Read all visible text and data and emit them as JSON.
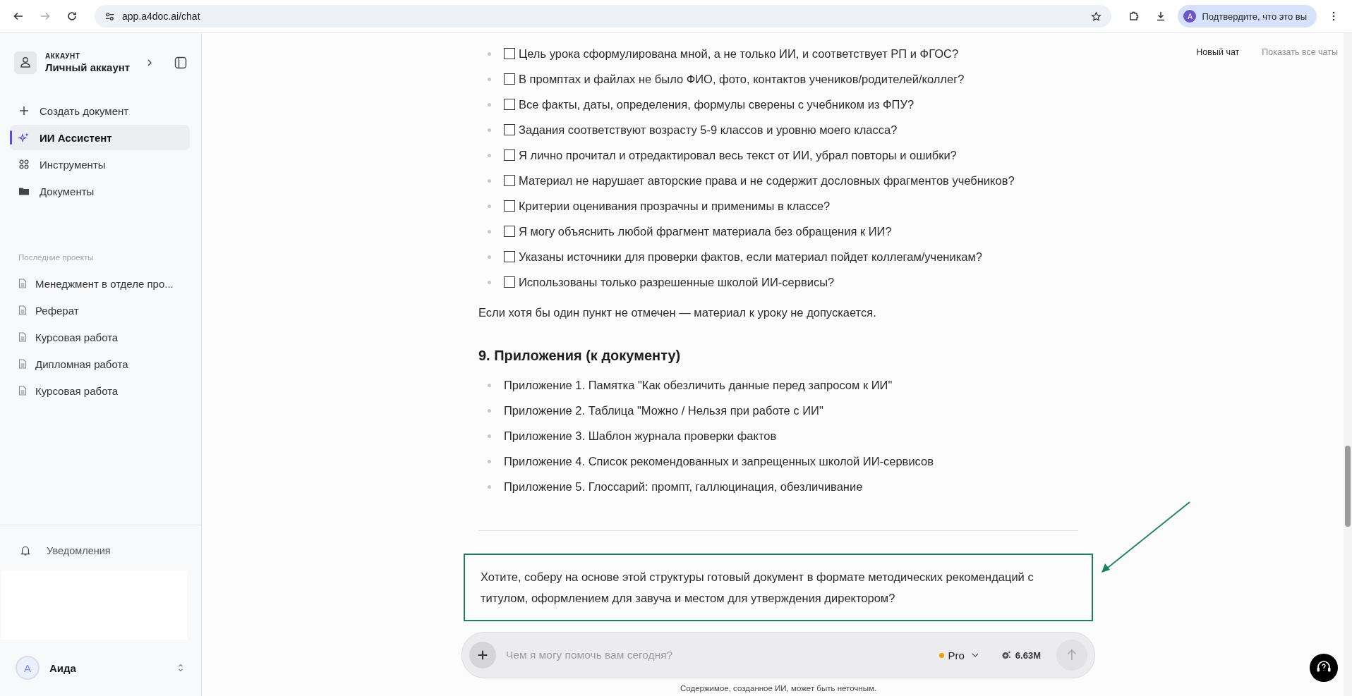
{
  "browser": {
    "url": "app.a4doc.ai/chat",
    "profile_initial": "A",
    "profile_label": "Подтвердите, что это вы"
  },
  "sidebar": {
    "account": {
      "caption": "АККАУНТ",
      "name": "Личный аккаунт"
    },
    "nav": [
      {
        "label": "Создать документ",
        "kind": "plus",
        "selected": false
      },
      {
        "label": "ИИ Ассистент",
        "kind": "sparkle",
        "selected": true
      },
      {
        "label": "Инструменты",
        "kind": "grid",
        "selected": false
      },
      {
        "label": "Документы",
        "kind": "folder",
        "selected": false
      }
    ],
    "recent_title": "Последние проекты",
    "recent": [
      "Менеджмент в отделе про...",
      "Реферат",
      "Курсовая работа",
      "Дипломная работа",
      "Курсовая работа"
    ],
    "notifications": "Уведомления",
    "user": {
      "initial": "A",
      "name": "Аида"
    }
  },
  "header_links": [
    "Новый чат",
    "Показать все чаты"
  ],
  "checklist": [
    {
      "text": "Цель урока сформулирована мной, а не только ИИ, и соответствует РП и ФГОС?",
      "checked": false
    },
    {
      "text": "В промптах и файлах не было ФИО, фото, контактов учеников/родителей/коллег?",
      "checked": false
    },
    {
      "text": "Все факты, даты, определения, формулы сверены с учебником из ФПУ?",
      "checked": false
    },
    {
      "text": "Задания соответствуют возрасту 5-9 классов и уровню моего класса?",
      "checked": false
    },
    {
      "text": "Я лично прочитал и отредактировал весь текст от ИИ, убрал повторы и ошибки?",
      "checked": false
    },
    {
      "text": "Материал не нарушает авторские права и не содержит дословных фрагментов учебников?",
      "checked": false
    },
    {
      "text": "Критерии оценивания прозрачны и применимы в классе?",
      "checked": false
    },
    {
      "text": "Я могу объяснить любой фрагмент материала без обращения к ИИ?",
      "checked": false
    },
    {
      "text": "Указаны источники для проверки фактов, если материал пойдет коллегам/ученикам?",
      "checked": false
    },
    {
      "text": "Использованы только разрешенные школой ИИ-сервисы?",
      "checked": false
    }
  ],
  "note": "Если хотя бы один пункт не отмечен — материал к уроку не допускается.",
  "section": {
    "title": "9. Приложения (к документу)",
    "items": [
      "Приложение 1. Памятка \"Как обезличить данные перед запросом к ИИ\"",
      "Приложение 2. Таблица \"Можно / Нельзя при работе с ИИ\"",
      "Приложение 3. Шаблон журнала проверки фактов",
      "Приложение 4. Список рекомендованных и запрещенных школой ИИ-сервисов",
      "Приложение 5. Глоссарий: промпт, галлюцинация, обезличивание"
    ]
  },
  "question": "Хотите, соберу на основе этой структуры готовый документ в формате методических рекомендаций с титулом, оформлением для завуча и местом для утверждения директором?",
  "composer": {
    "placeholder": "Чем я могу помочь вам сегодня?",
    "model": "Pro",
    "tokens": "6.63M"
  },
  "disclaimer": "Содержимое, созданное ИИ, может быть неточным."
}
